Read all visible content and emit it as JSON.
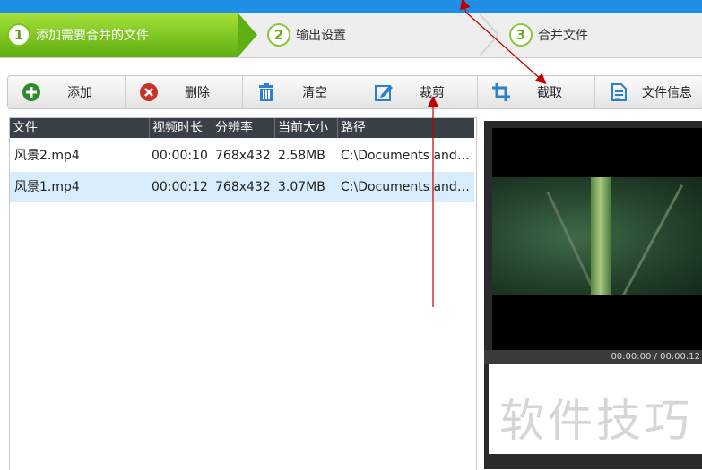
{
  "steps": [
    {
      "num": "1",
      "label": "添加需要合并的文件",
      "active": true
    },
    {
      "num": "2",
      "label": "输出设置",
      "active": false
    },
    {
      "num": "3",
      "label": "合并文件",
      "active": false
    }
  ],
  "toolbar": {
    "add": "添加",
    "delete": "删除",
    "clear": "清空",
    "crop": "裁剪",
    "trim": "截取",
    "file_info": "文件信息"
  },
  "table": {
    "columns": [
      "文件",
      "视频时长",
      "分辨率",
      "当前大小",
      "路径"
    ],
    "rows": [
      {
        "name": "风景2.mp4",
        "duration": "00:00:10",
        "resolution": "768x432",
        "size": "2.58MB",
        "path": "C:\\Documents and ..."
      },
      {
        "name": "风景1.mp4",
        "duration": "00:00:12",
        "resolution": "768x432",
        "size": "3.07MB",
        "path": "C:\\Documents and ..."
      }
    ]
  },
  "preview": {
    "time": "00:00:00 / 00:00:12"
  },
  "watermark": "软件技巧",
  "colors": {
    "accent_green": "#6ab81a",
    "header_dark": "#3a4047",
    "selected_row": "#d9ecfb",
    "title_blue": "#1f8fe6",
    "annotation_red": "#c00000"
  }
}
